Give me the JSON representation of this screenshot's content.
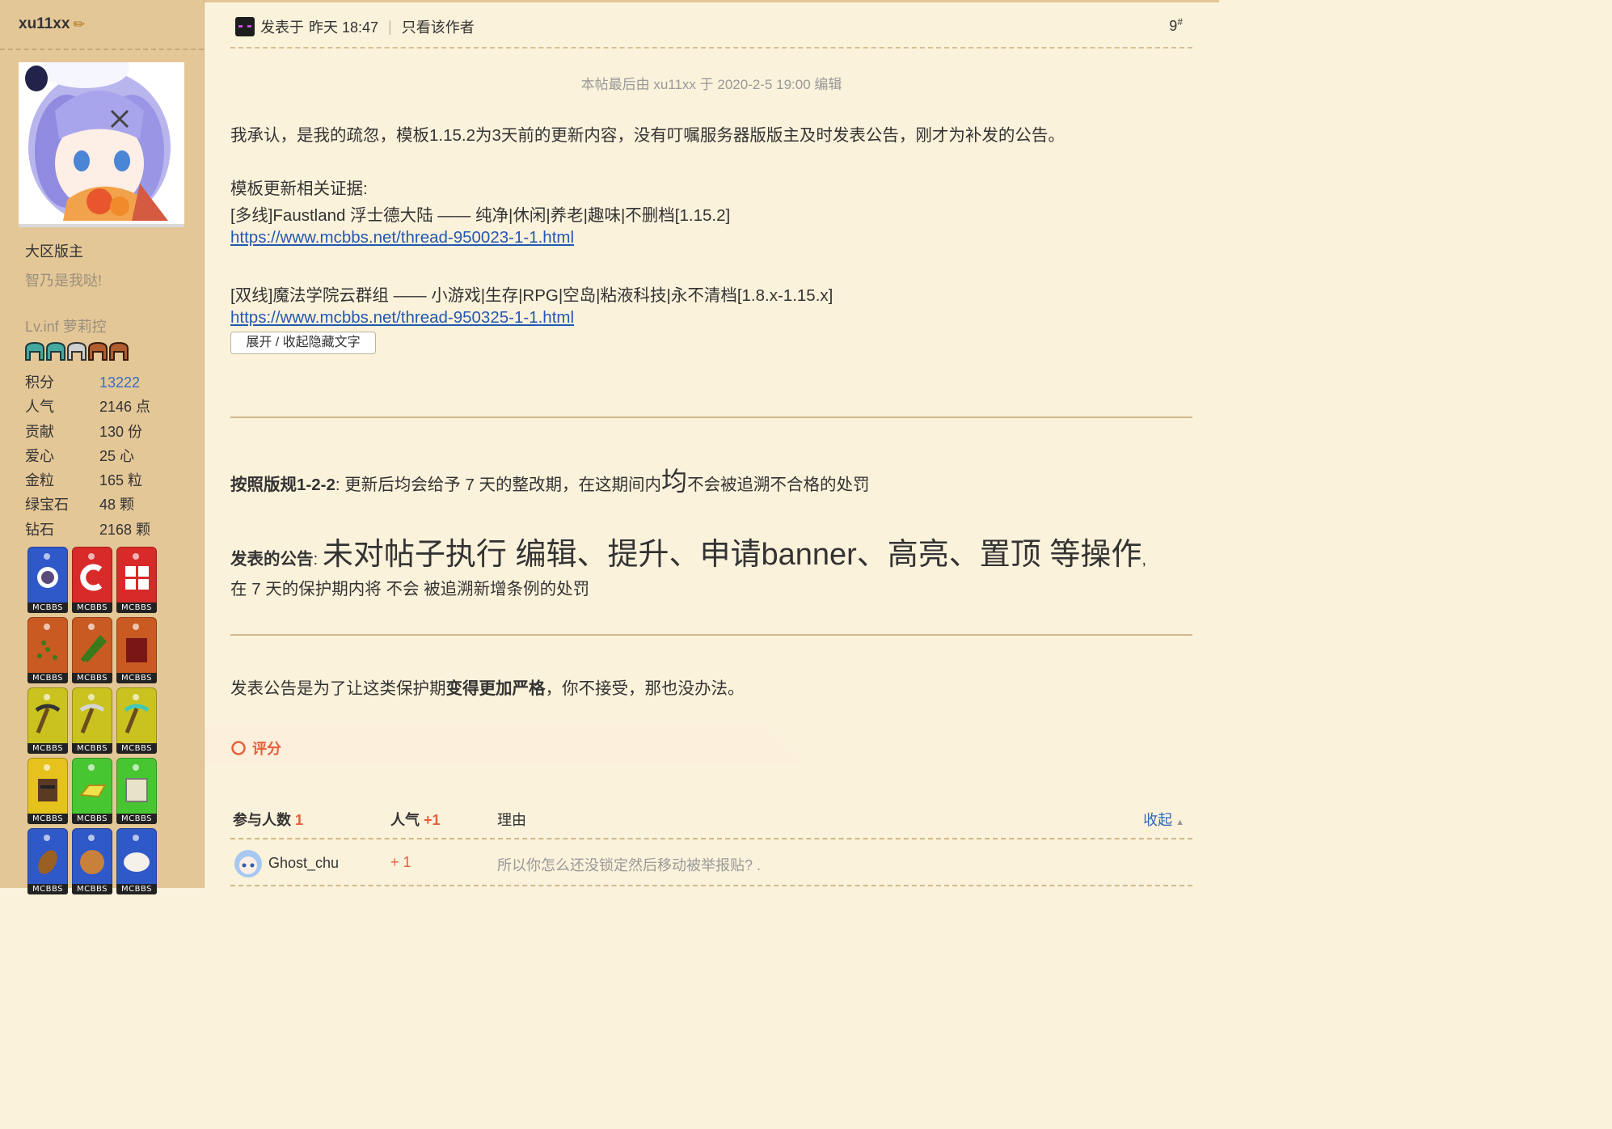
{
  "sidebar": {
    "username": "xu11xx",
    "group": "大区版主",
    "custom_title": "智乃是我哒!",
    "level": "Lv.inf 萝莉控",
    "stats": [
      {
        "label": "积分",
        "value": "13222"
      },
      {
        "label": "人气",
        "value": "2146 点"
      },
      {
        "label": "贡献",
        "value": "130 份"
      },
      {
        "label": "爱心",
        "value": "25 心"
      },
      {
        "label": "金粒",
        "value": "165 粒"
      },
      {
        "label": "绿宝石",
        "value": "48 颗"
      },
      {
        "label": "钻石",
        "value": "2168 颗"
      }
    ],
    "medal_label": "MCBBS"
  },
  "post": {
    "posted_label": "发表于",
    "posted_time": "昨天 18:47",
    "separator": "|",
    "only_author": "只看该作者",
    "floor_number": "9",
    "floor_sup": "#",
    "edit_note": "本帖最后由 xu11xx 于 2020-2-5 19:00 编辑",
    "line1": "我承认，是我的疏忽，模板1.15.2为3天前的更新内容，没有叮嘱服务器版版主及时发表公告，刚才为补发的公告。",
    "evidence_title": "模板更新相关证据:",
    "server1": "[多线]Faustland 浮士德大陆 —— 纯净|休闲|养老|趣味|不删档[1.15.2]",
    "link1": "https://www.mcbbs.net/thread-950023-1-1.html",
    "server2": "[双线]魔法学院云群组 —— 小游戏|生存|RPG|空岛|粘液科技|永不清档[1.8.x-1.15.x]",
    "link2": "https://www.mcbbs.net/thread-950325-1-1.html",
    "toggle_button": "展开 / 收起隐藏文字",
    "rule_bold": "按照版规1-2-2",
    "rule_text_a": ": 更新后均会给予 7 天的整改期，在这期间内",
    "rule_big": "均",
    "rule_text_b": "不会被追溯不合格的处罚",
    "announce_bold": "发表的公告",
    "announce_colon": ": ",
    "announce_big": "未对帖子执行 编辑、提升、申请banner、高亮、置顶 等操作",
    "announce_comma": ",",
    "announce_line2": "在 7 天的保护期内将 不会 被追溯新增条例的处罚",
    "closing_a": "发表公告是为了让这类保护期",
    "closing_bold": "变得更加严格",
    "closing_b": "，你不接受，那也没办法。"
  },
  "rating": {
    "title": "评分",
    "participants_label": "参与人数",
    "participants_count": "1",
    "popularity_label": "人气",
    "popularity_total": "+1",
    "reason_label": "理由",
    "collapse_label": "收起",
    "entries": [
      {
        "user": "Ghost_chu",
        "popularity": "+ 1",
        "reason": "所以你怎么还没锁定然后移动被举报贴? ."
      }
    ]
  },
  "colors": {
    "sidebar_bg": "#e4c797",
    "page_bg": "#fbf2db",
    "link": "#2357b3",
    "accent_red": "#e4603a"
  }
}
